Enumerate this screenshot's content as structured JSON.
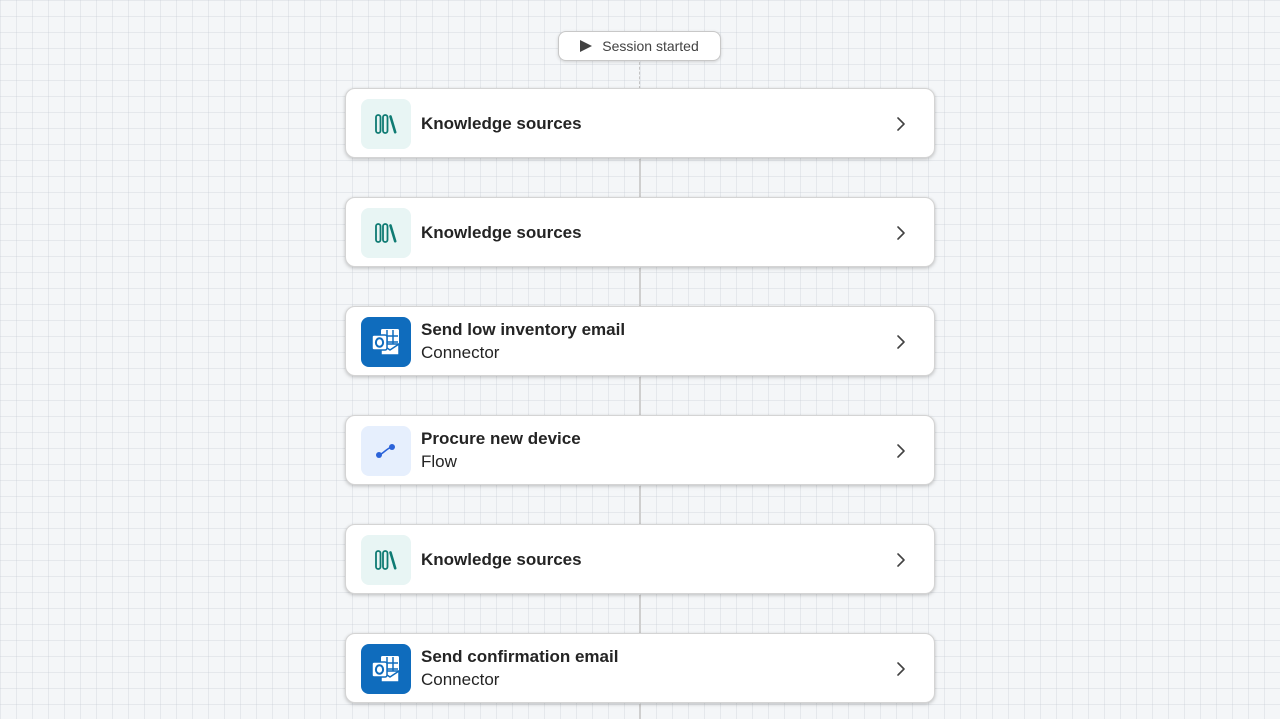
{
  "session": {
    "label": "Session started"
  },
  "steps": [
    {
      "title": "Knowledge sources",
      "subtitle": null,
      "icon": "knowledge-books-icon"
    },
    {
      "title": "Knowledge sources",
      "subtitle": null,
      "icon": "knowledge-books-icon"
    },
    {
      "title": "Send low inventory email",
      "subtitle": "Connector",
      "icon": "outlook-icon"
    },
    {
      "title": "Procure new device",
      "subtitle": "Flow",
      "icon": "flow-icon"
    },
    {
      "title": "Knowledge sources",
      "subtitle": null,
      "icon": "knowledge-books-icon"
    },
    {
      "title": "Send confirmation email",
      "subtitle": "Connector",
      "icon": "outlook-icon"
    }
  ],
  "colors": {
    "knowledge_accent": "#0f7b73",
    "outlook_blue": "#0f6cbd",
    "flow_blue": "#2b63d9",
    "text": "#242424"
  }
}
